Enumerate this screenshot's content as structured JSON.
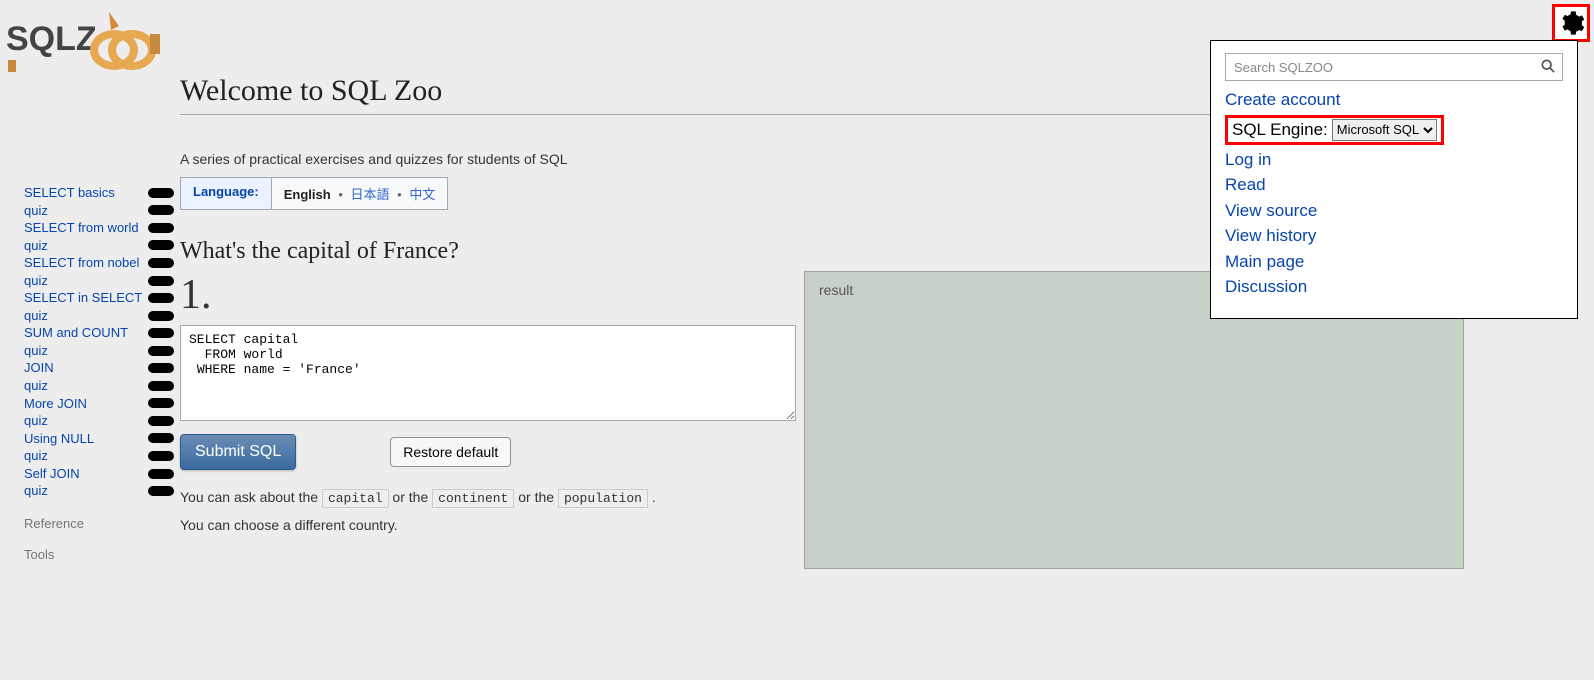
{
  "logo_text": "SQLZOO",
  "gear": {
    "name": "gear-icon"
  },
  "menu": {
    "search_placeholder": "Search SQLZOO",
    "create_account": "Create account",
    "sql_engine_label": "SQL Engine:",
    "sql_engine_selected": "Microsoft SQL",
    "log_in": "Log in",
    "read": "Read",
    "view_source": "View source",
    "view_history": "View history",
    "main_page": "Main page",
    "discussion": "Discussion"
  },
  "sidebar": {
    "items": [
      {
        "label": "SELECT basics",
        "pill": true
      },
      {
        "label": "quiz",
        "pill": true
      },
      {
        "label": "SELECT from world",
        "pill": true
      },
      {
        "label": "quiz",
        "pill": true
      },
      {
        "label": "SELECT from nobel",
        "pill": true
      },
      {
        "label": "quiz",
        "pill": true
      },
      {
        "label": "SELECT in SELECT",
        "pill": true
      },
      {
        "label": "quiz",
        "pill": true
      },
      {
        "label": "SUM and COUNT",
        "pill": true
      },
      {
        "label": "quiz",
        "pill": true
      },
      {
        "label": "JOIN",
        "pill": true
      },
      {
        "label": "quiz",
        "pill": true
      },
      {
        "label": "More JOIN",
        "pill": true
      },
      {
        "label": "quiz",
        "pill": true
      },
      {
        "label": "Using NULL",
        "pill": true
      },
      {
        "label": "quiz",
        "pill": true
      },
      {
        "label": "Self JOIN",
        "pill": true
      },
      {
        "label": "quiz",
        "pill": true
      }
    ],
    "reference": "Reference",
    "tools": "Tools"
  },
  "page": {
    "title": "Welcome to SQL Zoo",
    "intro": "A series of practical exercises and quizzes for students of SQL",
    "lang_label": "Language:",
    "lang_current": "English",
    "lang_jp": "日本語",
    "lang_cn": "中文",
    "section_title": "What's the capital of France?",
    "qnum": "1.",
    "sql": "SELECT capital\n  FROM world\n WHERE name = 'France'",
    "submit": "Submit SQL",
    "restore": "Restore default",
    "hint1_pre": "You can ask about the ",
    "hint1_c1": "capital",
    "hint1_mid1": " or the ",
    "hint1_c2": "continent",
    "hint1_mid2": " or the ",
    "hint1_c3": "population",
    "hint1_post": " .",
    "hint2": "You can choose a different country.",
    "result_label": "result"
  }
}
